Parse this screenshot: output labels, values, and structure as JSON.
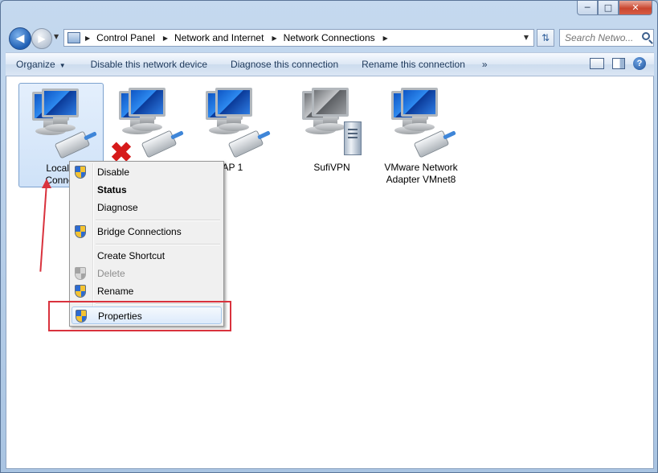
{
  "address": {
    "breadcrumbs": [
      "Control Panel",
      "Network and Internet",
      "Network Connections"
    ]
  },
  "search": {
    "placeholder": "Search Netwo..."
  },
  "toolbar": {
    "organize_label": "Organize",
    "disable_label": "Disable this network device",
    "diagnose_label": "Diagnose this connection",
    "rename_label": "Rename this connection",
    "more_label": "»",
    "help_label": "?"
  },
  "connections": [
    {
      "label_line1": "Local A",
      "label_line2": "Connec",
      "selected": true
    },
    {
      "label_line1": "",
      "label_line2": "",
      "status": "disconnected"
    },
    {
      "label_line1": "SSTAP 1",
      "label_line2": ""
    },
    {
      "label_line1": "SufiVPN",
      "label_line2": ""
    },
    {
      "label_line1": "VMware Network",
      "label_line2": "Adapter VMnet8"
    }
  ],
  "context_menu": {
    "items": [
      {
        "label": "Disable",
        "shield": true
      },
      {
        "label": "Status",
        "bold": true
      },
      {
        "label": "Diagnose"
      },
      {
        "label": "Bridge Connections",
        "shield": true
      },
      {
        "label": "Create Shortcut"
      },
      {
        "label": "Delete",
        "shield": true,
        "disabled": true
      },
      {
        "label": "Rename",
        "shield": true
      },
      {
        "label": "Properties",
        "shield": true,
        "highlighted": true
      }
    ]
  },
  "colors": {
    "annotation": "#d9323d",
    "selection": "#cfe2f8"
  }
}
